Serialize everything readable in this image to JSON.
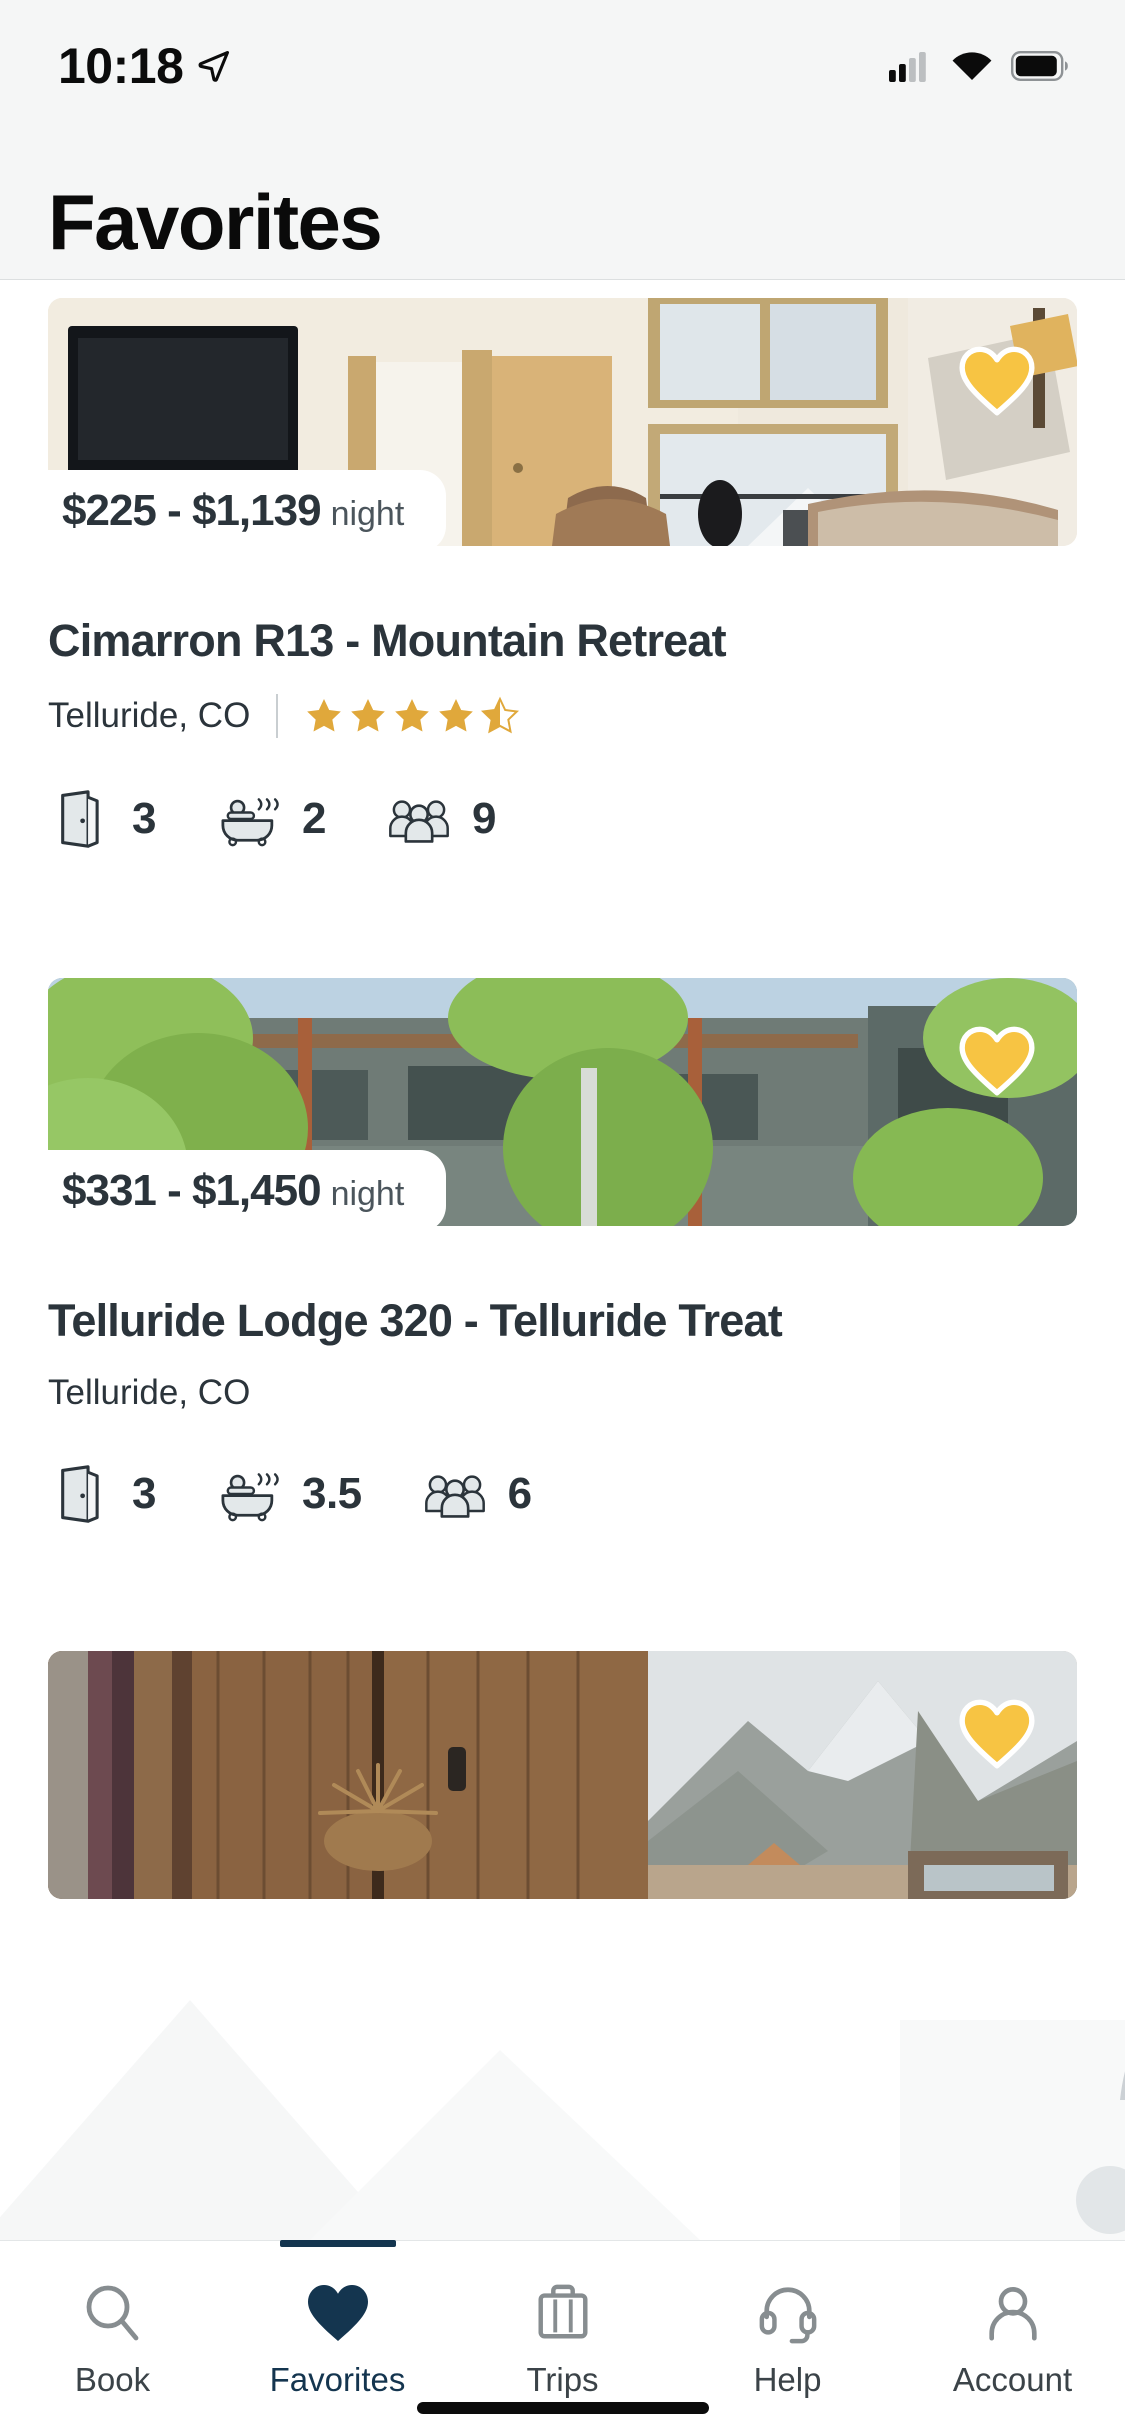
{
  "status_bar": {
    "time": "10:18",
    "location_icon": "location-arrow-icon",
    "signal_icon": "cellular-signal-icon",
    "signal_bars_filled": 2,
    "signal_bars_total": 4,
    "wifi_icon": "wifi-icon",
    "battery_icon": "battery-icon",
    "battery_level": 0.82
  },
  "header": {
    "title": "Favorites"
  },
  "theme": {
    "accent_navy": "#14354f",
    "heart_gold": "#f7c443",
    "star_gold": "#e0a83b",
    "text_dark": "#2b343b",
    "bg_light": "#f5f6f6"
  },
  "listings": [
    {
      "price_range": "$225 - $1,139",
      "price_unit": "night",
      "title": "Cimarron R13 - Mountain Retreat",
      "location": "Telluride, CO",
      "rating": 4.5,
      "has_rating": true,
      "favorite": true,
      "favorite_icon": "heart-icon",
      "stats": [
        {
          "icon": "door-icon",
          "label": "bedrooms",
          "value": "3"
        },
        {
          "icon": "bathtub-icon",
          "label": "bathrooms",
          "value": "2"
        },
        {
          "icon": "guests-icon",
          "label": "guests",
          "value": "9"
        }
      ]
    },
    {
      "price_range": "$331 - $1,450",
      "price_unit": "night",
      "title": "Telluride Lodge 320 - Telluride Treat",
      "location": "Telluride, CO",
      "rating": null,
      "has_rating": false,
      "favorite": true,
      "favorite_icon": "heart-icon",
      "stats": [
        {
          "icon": "door-icon",
          "label": "bedrooms",
          "value": "3"
        },
        {
          "icon": "bathtub-icon",
          "label": "bathrooms",
          "value": "3.5"
        },
        {
          "icon": "guests-icon",
          "label": "guests",
          "value": "6"
        }
      ]
    },
    {
      "price_range": "",
      "price_unit": "",
      "title": "",
      "location": "",
      "rating": null,
      "has_rating": false,
      "favorite": true,
      "favorite_icon": "heart-icon",
      "stats": []
    }
  ],
  "tabbar": {
    "active_index": 1,
    "items": [
      {
        "label": "Book",
        "icon": "search-icon"
      },
      {
        "label": "Favorites",
        "icon": "heart-icon"
      },
      {
        "label": "Trips",
        "icon": "suitcase-icon"
      },
      {
        "label": "Help",
        "icon": "headset-icon"
      },
      {
        "label": "Account",
        "icon": "person-icon"
      }
    ]
  }
}
